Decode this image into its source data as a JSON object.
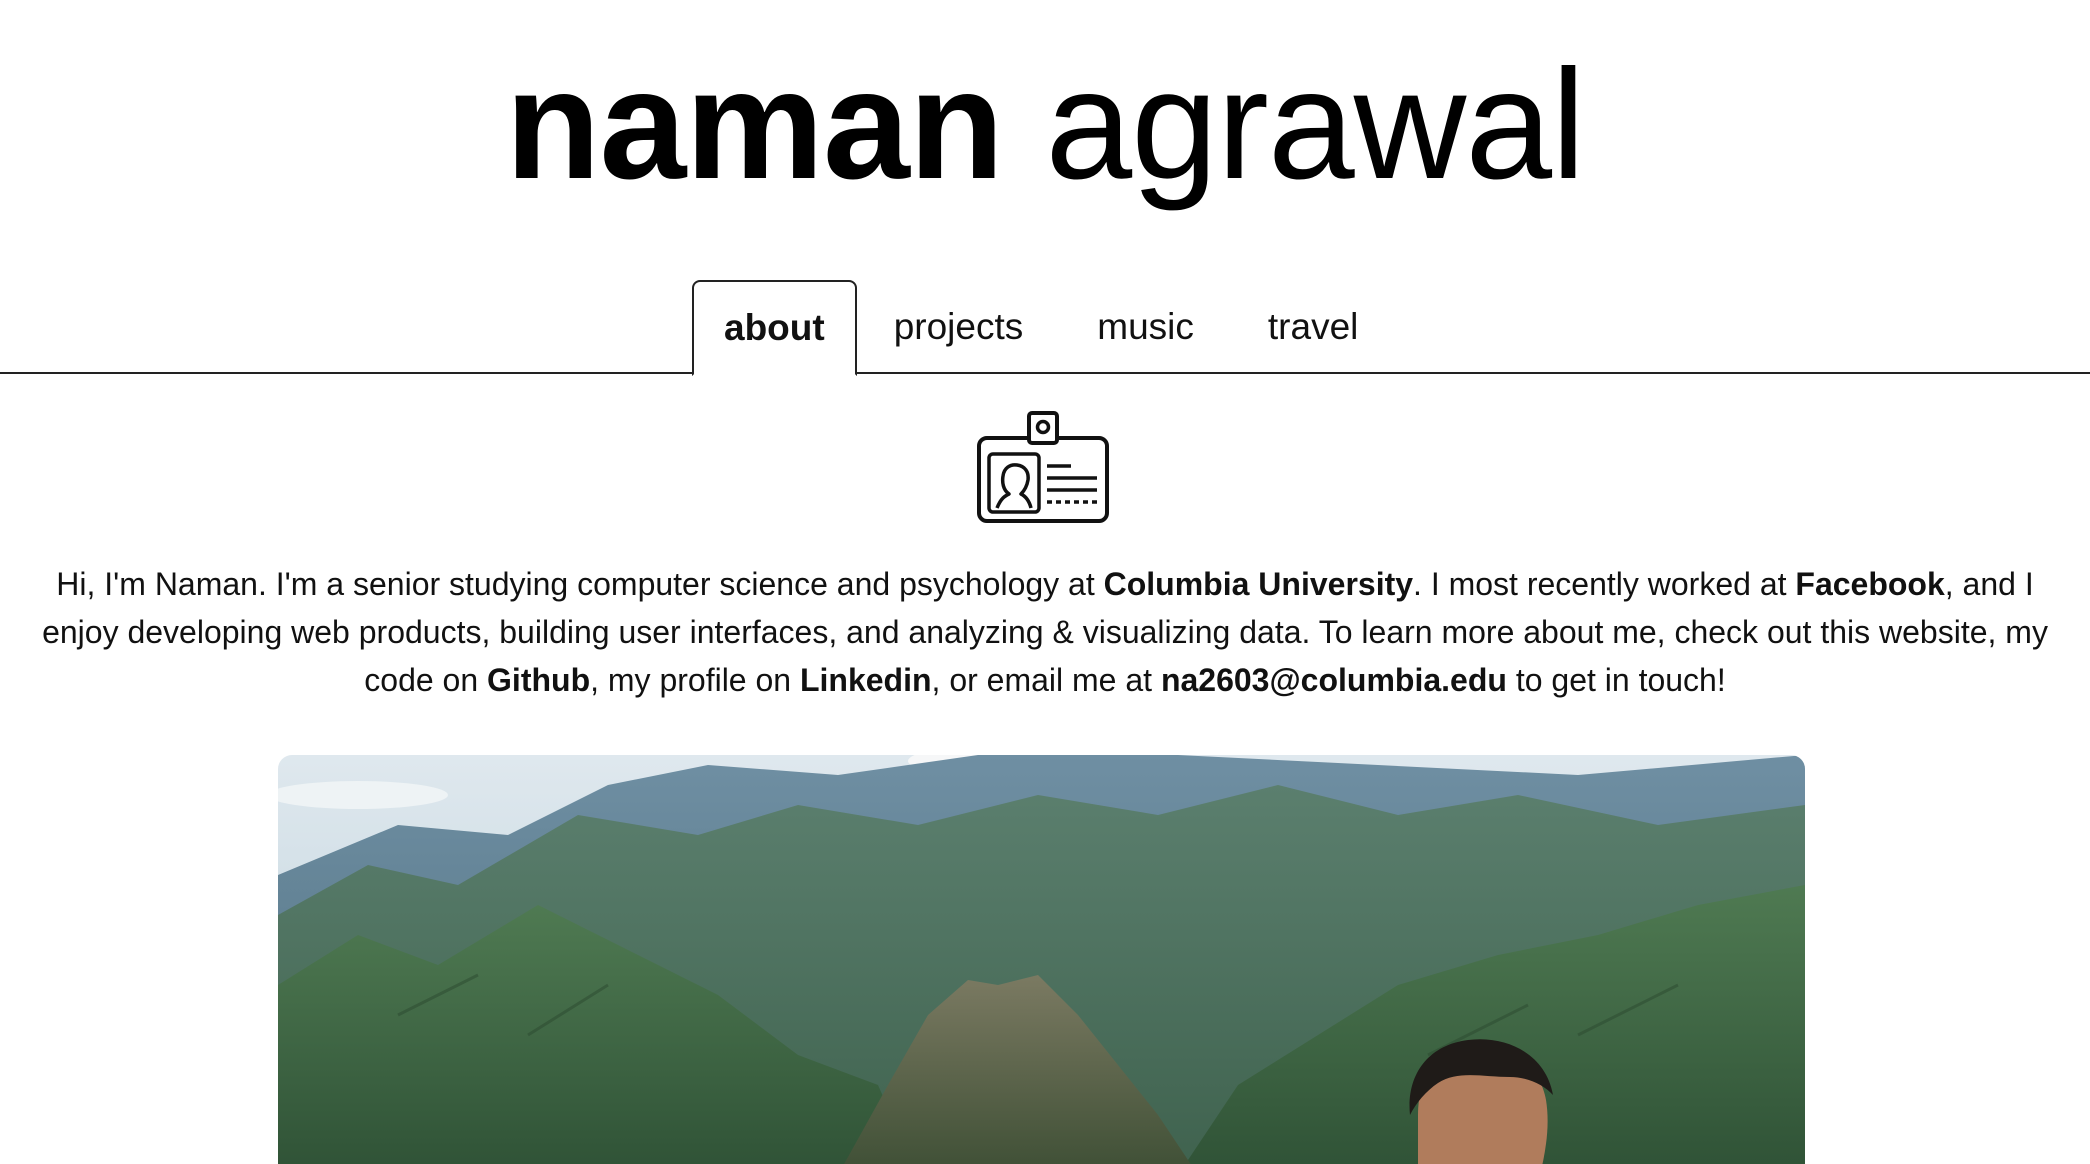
{
  "header": {
    "first_name": "naman",
    "last_name": "agrawal"
  },
  "tabs": [
    {
      "label": "about",
      "active": true
    },
    {
      "label": "projects",
      "active": false
    },
    {
      "label": "music",
      "active": false
    },
    {
      "label": "travel",
      "active": false
    }
  ],
  "icon": "id-badge-icon",
  "intro": {
    "p1": "Hi, I'm Naman. I'm a senior studying computer science and psychology at ",
    "university": "Columbia University",
    "p2": ". I most recently worked at ",
    "company": "Facebook",
    "p3": ", and I enjoy developing web products, building user interfaces, and analyzing & visualizing data. To learn more about me, check out this website, my code on ",
    "github": "Github",
    "p4": ", my profile on ",
    "linkedin": "Linkedin",
    "p5": ", or email me at ",
    "email": "na2603@columbia.edu",
    "p6": " to get in touch!"
  },
  "photo": {
    "subject": "mountain-landscape-photo"
  }
}
